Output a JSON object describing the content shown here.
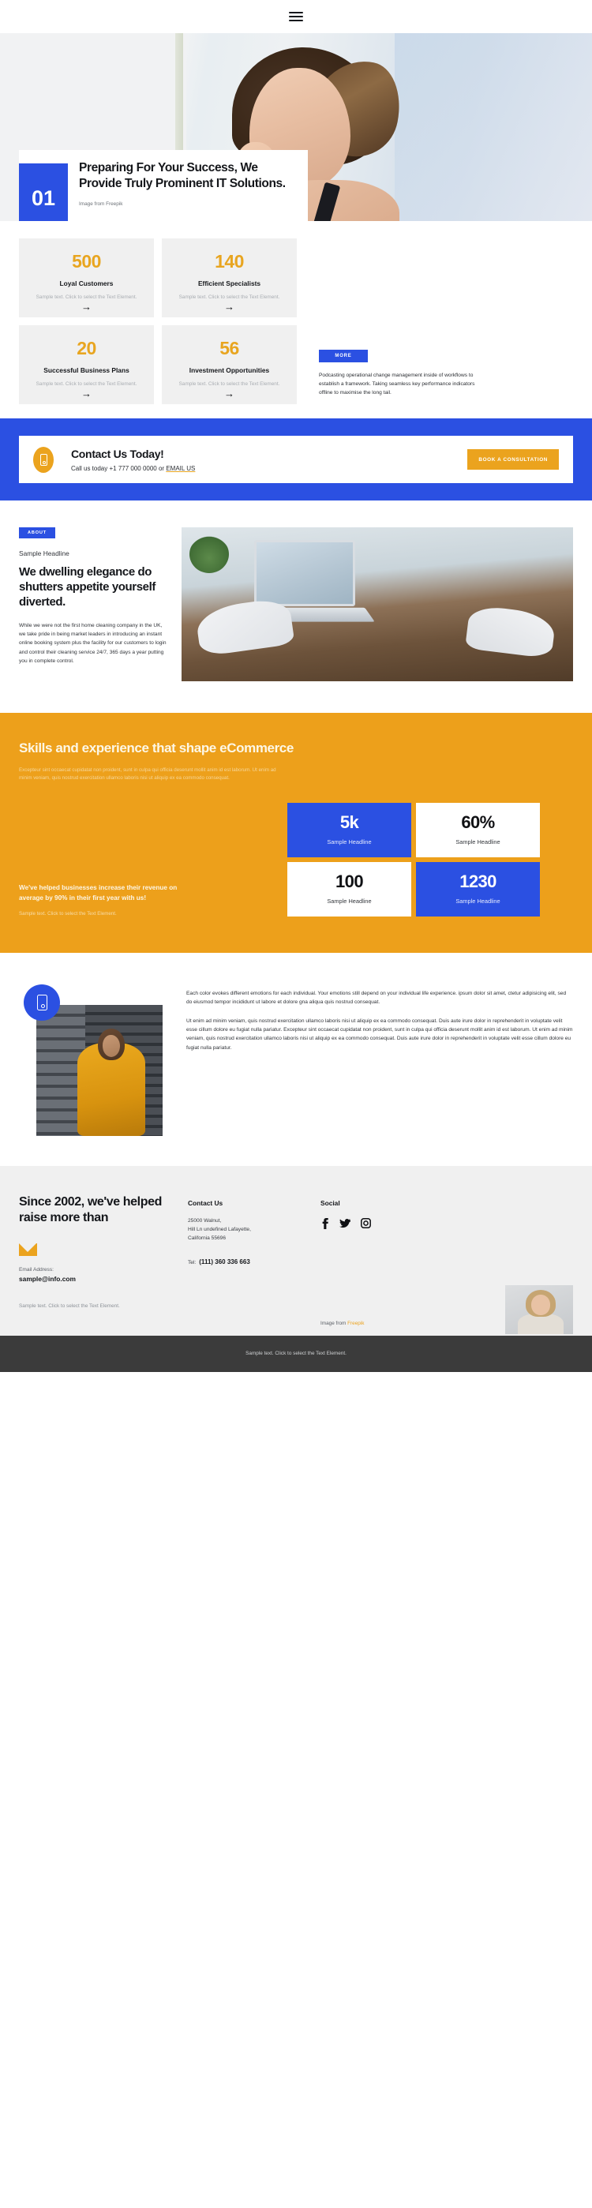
{
  "nav": {
    "menu_icon": "hamburger-menu-icon"
  },
  "hero": {
    "number": "01",
    "headline": "Preparing For Your Success, We Provide Truly Prominent IT Solutions.",
    "credit": "Image from  Freepik"
  },
  "stats": {
    "cards": [
      {
        "number": "500",
        "label": "Loyal Customers",
        "desc": "Sample text. Click to select the Text Element.",
        "arrow": "→"
      },
      {
        "number": "140",
        "label": "Efficient Specialists",
        "desc": "Sample text. Click to select the Text Element.",
        "arrow": "→"
      },
      {
        "number": "20",
        "label": "Successful Business Plans",
        "desc": "Sample text. Click to select the Text Element.",
        "arrow": "→"
      },
      {
        "number": "56",
        "label": "Investment Opportunities",
        "desc": "Sample text. Click to select the Text Element.",
        "arrow": "→"
      }
    ],
    "more_label": "MORE",
    "side_paragraph": "Podcasting operational change management inside of workflows to establish a framework. Taking seamless key performance indicators offline to maximise the long tail."
  },
  "cta": {
    "title": "Contact Us Today!",
    "sub_prefix": "Call us today +1 777 000 0000 or ",
    "email_link": "EMAIL US",
    "button": "BOOK A CONSULTATION",
    "icon": "mobile-phone-icon"
  },
  "about": {
    "pill": "ABOUT",
    "eyebrow": "Sample Headline",
    "heading": "We dwelling elegance do shutters appetite yourself diverted.",
    "paragraph": "While we were not the first home cleaning company in the UK, we take pride in being market leaders in introducing an instant online booking system plus the facility for our customers to login and control their cleaning service 24/7, 365 days a year putting you in complete control."
  },
  "skills": {
    "heading": "Skills and experience that shape eCommerce",
    "paragraph": "Excepteur sint occaecat cupidatat non proident, sunt in culpa qui officia deserunt mollit anim id est laborum. Ut enim ad minim veniam, quis nostrud exercitation ullamco laboris nisi ut aliquip ex ea commodo consequat.",
    "claim": "We've helped businesses increase their revenue on average by 90% in their first year with us!",
    "note": "Sample text. Click to select the Text Element.",
    "tiles": [
      {
        "number": "5k",
        "label": "Sample Headline",
        "style": "blue"
      },
      {
        "number": "60%",
        "label": "Sample Headline",
        "style": "white"
      },
      {
        "number": "100",
        "label": "Sample Headline",
        "style": "white"
      },
      {
        "number": "1230",
        "label": "Sample Headline",
        "style": "blue"
      }
    ]
  },
  "feature": {
    "badge_icon": "mobile-phone-icon",
    "paragraph_1": "Each color evokes different emotions for each individual. Your emotions still depend on your individual life experience. ipsum dolor sit amet, ctetur adipisicing elit, sed do eiusmod tempor incididunt ut labore et dolore gna aliqua quis nostrud consequat.",
    "paragraph_2": "Ut enim ad minim veniam, quis nostrud exercitation ullamco laboris nisi ut aliquip ex ea commodo consequat. Duis aute irure dolor in reprehenderit in voluptate velit esse cillum dolore eu fugiat nulla pariatur. Excepteur sint occaecat cupidatat non proident, sunt in culpa qui officia deserunt mollit anim id est laborum. Ut enim ad minim veniam, quis nostrud exercitation ullamco laboris nisi ut aliquip ex ea commodo consequat. Duis aute irure dolor in reprehenderit in voluptate velit esse cillum dolore eu fugiat nulla pariatur."
  },
  "footer": {
    "heading": "Since 2002, we've helped raise more than",
    "mail_icon": "envelope-icon",
    "email_label": "Email Address:",
    "email_value": "sample@info.com",
    "note": "Sample text. Click to select the Text Element.",
    "contact_title": "Contact Us",
    "address": "25000 Walnut,\nHill Ln undefined Lafayette,\nCalifornia 55696",
    "tel_label": "Tel:",
    "tel_value": "(111) 360 336 663",
    "social_title": "Social",
    "socials": [
      "facebook-icon",
      "twitter-icon",
      "instagram-icon"
    ],
    "credit_prefix": "Image from ",
    "credit_link": "Freepik"
  },
  "bottom": {
    "text": "Sample text. Click to select the Text Element."
  },
  "colors": {
    "blue": "#2b50e2",
    "orange": "#eda01b",
    "amber": "#eba31e",
    "dark": "#3b3b3b"
  }
}
